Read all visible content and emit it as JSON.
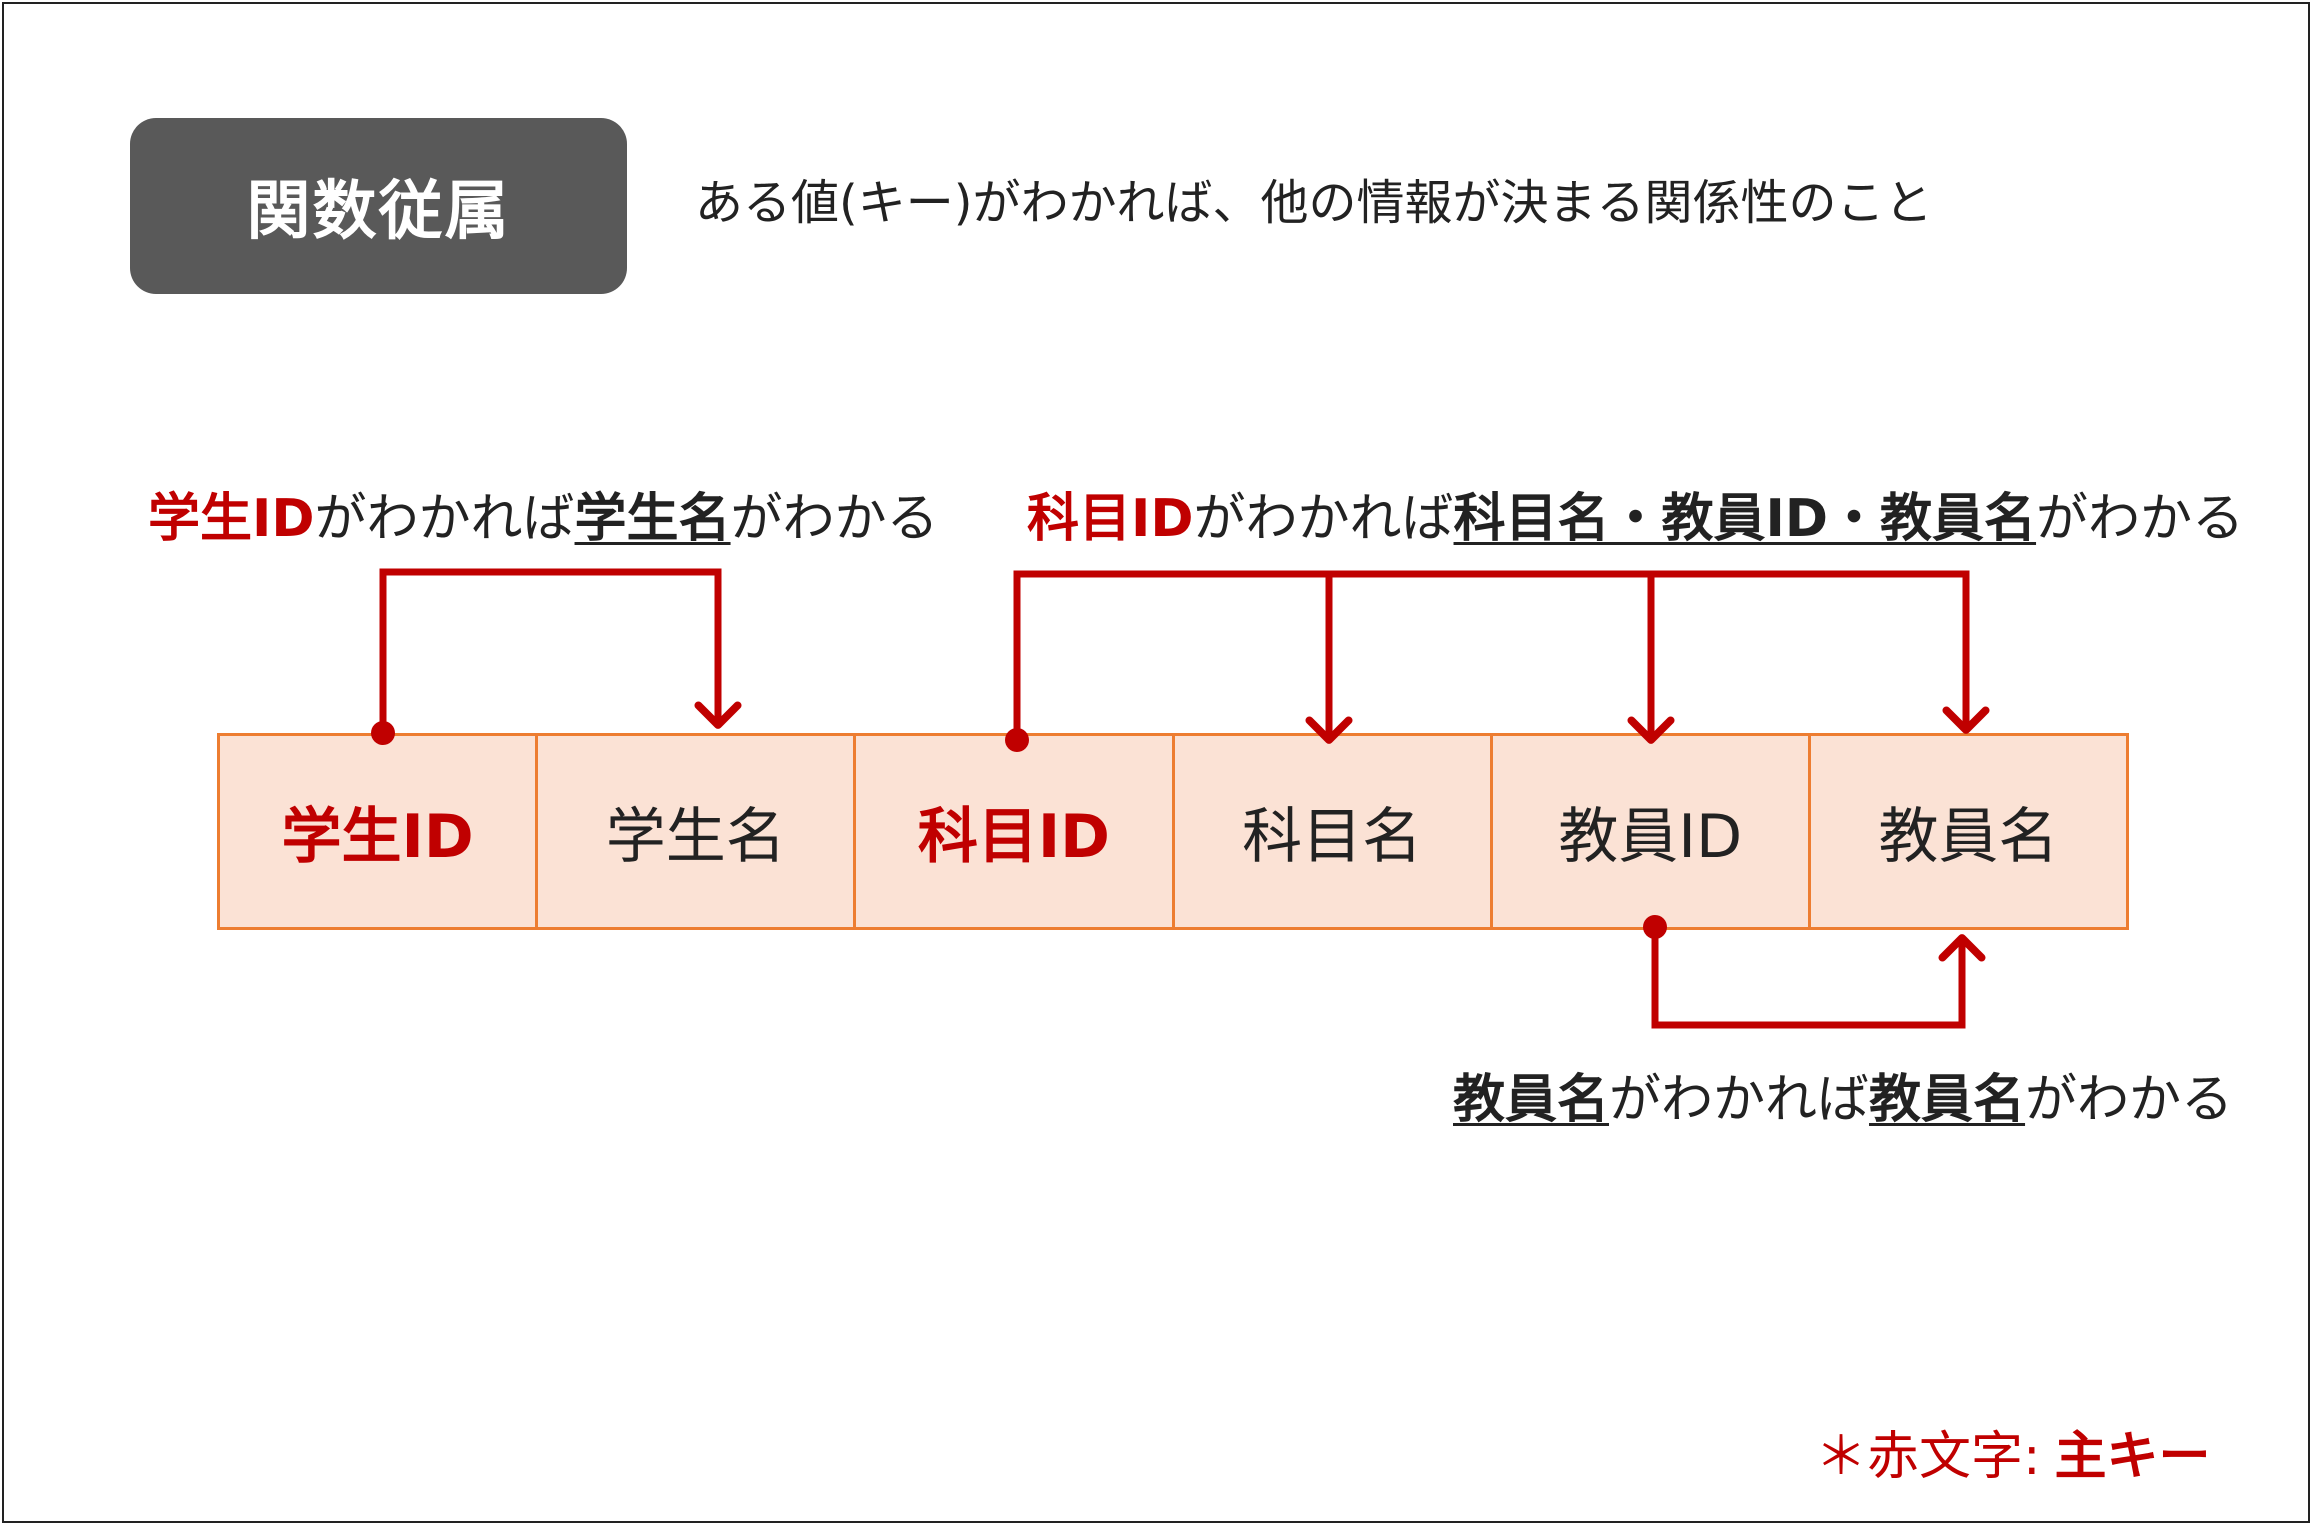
{
  "title": "関数従属",
  "definition": "ある値(キー)がわかれば、他の情報が決まる関係性のこと",
  "columns": [
    {
      "label": "学生ID",
      "is_key": true
    },
    {
      "label": "学生名",
      "is_key": false
    },
    {
      "label": "科目ID",
      "is_key": true
    },
    {
      "label": "科目名",
      "is_key": false
    },
    {
      "label": "教員ID",
      "is_key": false
    },
    {
      "label": "教員名",
      "is_key": false
    }
  ],
  "captions": {
    "student": {
      "key": "学生ID",
      "mid": "がわかれば",
      "target": "学生名",
      "tail": "がわかる"
    },
    "subject": {
      "key": "科目ID",
      "mid": "がわかれば",
      "target": "科目名・教員ID・教員名",
      "tail": "がわかる"
    },
    "teacher": {
      "key": "教員名",
      "mid": "がわかれば",
      "target": "教員名",
      "tail": "がわかる"
    }
  },
  "legend": {
    "prefix": "＊赤文字:",
    "value": "主キー"
  },
  "colors": {
    "key_red": "#c00000",
    "cell_fill": "#fbe2d5",
    "cell_border": "#ed7d31",
    "badge": "#595959"
  }
}
